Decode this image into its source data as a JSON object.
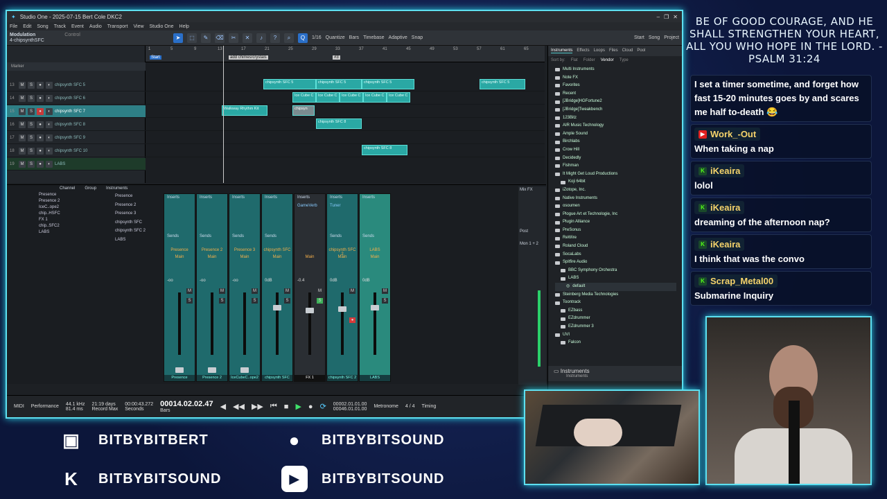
{
  "window": {
    "title": "Studio One - 2025-07-15 Bert Cole DKC2"
  },
  "menu": [
    "File",
    "Edit",
    "Song",
    "Track",
    "Event",
    "Audio",
    "Transport",
    "View",
    "Studio One",
    "Help"
  ],
  "toolbar": {
    "preset": "Modulation",
    "param": "Control",
    "track": "4-chipsynthSFC",
    "quantize": "1/16",
    "timebase": "Bars",
    "snap": "Adaptive",
    "start": "Start",
    "song": "Song",
    "project": "Project",
    "quantize_label": "Quantize",
    "timebase_label": "Timebase",
    "snap_label": "Snap"
  },
  "arrange": {
    "marker_label": "Marker",
    "ruler_ticks": [
      "1",
      "5",
      "9",
      "13",
      "17",
      "21",
      "25",
      "29",
      "33",
      "37",
      "41",
      "45",
      "49",
      "53",
      "57",
      "61",
      "65"
    ],
    "ruler_markers": [
      "Start",
      "add chimes/crystals",
      "#3"
    ],
    "tracks": [
      {
        "num": "13",
        "name": "chipsynth SFC 5"
      },
      {
        "num": "14",
        "name": "chipsynth SFC 6"
      },
      {
        "num": "15",
        "name": "chipsynth SFC 7"
      },
      {
        "num": "16",
        "name": "chipsynth SFC 8"
      },
      {
        "num": "17",
        "name": "chipsynth SFC 9"
      },
      {
        "num": "18",
        "name": "chipsynth SFC 10"
      },
      {
        "num": "19",
        "name": "LABS"
      }
    ],
    "clips": {
      "c1": "chipsynth SFC 5",
      "c2": "chipsynth SFC 5",
      "c3": "chipsynth SFC 5",
      "c4": "chipsynth SFC 5",
      "ice": "Ice Cube C",
      "walk": "Walkway Rhythm Kit",
      "gray": "chipsyn",
      "c8": "chipsynth SFC 8",
      "c8b": "chipsynth SFC 8"
    }
  },
  "browser": {
    "tabs": [
      "Instruments",
      "Effects",
      "Loops",
      "Files",
      "Cloud",
      "Pool"
    ],
    "sort_label": "Sort by:",
    "sort": [
      "Flat",
      "Folder",
      "Vendor",
      "Type"
    ],
    "items": [
      "Multi Instruments",
      "Note FX",
      "Favorites",
      "Recent",
      "[JBridge]HGFortune2",
      "[JBridge]Tweakbench",
      "123Bitz",
      "AIR Music Technology",
      "Ample Sound",
      "Birchlabs",
      "Crow Hill",
      "Decidedly",
      "Fishman",
      "It Might Get Loud Productions",
      "Koji 64bit",
      "iZotope, Inc.",
      "Native Instruments",
      "osoumen",
      "Plogue Art et Technologie, Inc",
      "Plugin Alliance",
      "PreSonus",
      "ReWire",
      "Roland Cloud",
      "SocaLabs",
      "Spitfire Audio",
      "BBC Symphony Orchestra",
      "LABS",
      "default",
      "Steinberg Media Technologies",
      "Toontrack",
      "EZbass",
      "EZdrummer",
      "EZdrummer 3",
      "UVI",
      "Falcon"
    ],
    "footer_title": "Instruments",
    "footer_sub": "Instruments"
  },
  "mixer": {
    "channel_label": "Channel",
    "group_label": "Group",
    "instruments_label": "Instruments",
    "channels": [
      "Presence",
      "Presence 2",
      "IceC..ope2",
      "chip..HSFC",
      "FX 1",
      "chip..SFC2",
      "LABS"
    ],
    "instruments": [
      "Presence",
      "Presence 2",
      "Presence 3",
      "chipsynth SFC",
      "chipsynth SFC 2",
      "LABS"
    ],
    "inserts_label": "Inserts",
    "sends_label": "Sends",
    "strips": [
      {
        "name": "Presence",
        "out": "Main",
        "db": "-oo",
        "bot": "Presence"
      },
      {
        "name": "Presence 2",
        "out": "Main",
        "db": "-oo",
        "bot": "Presence 2"
      },
      {
        "name": "Presence 3",
        "out": "Main",
        "db": "-oo",
        "bot": "IceCubeC..ope2"
      },
      {
        "name": "chipsynth SFC",
        "out": "Main",
        "db": "0dB",
        "bot": "chipsynth SFC"
      },
      {
        "name": "",
        "out": "Main",
        "db": "-0.4",
        "bot": "FX 1"
      },
      {
        "name": "chipsynth SFC 2",
        "out": "Main",
        "db": "0dB",
        "bot": "chipsynth SFC 2"
      },
      {
        "name": "LABS",
        "out": "Main",
        "db": "0dB",
        "bot": "LABS"
      }
    ],
    "fx1": "FX 1",
    "gameverb": "GameVerb",
    "tuner": "Tuner",
    "mix_fx": "Mix FX",
    "post": "Post",
    "mon": "Mon 1 + 2"
  },
  "transport": {
    "rate": "44.1 kHz",
    "latency": "81.4 ms",
    "days": "21:19 days",
    "record_max": "Record Max",
    "seconds": "00:00:43.272",
    "seconds_label": "Seconds",
    "position": "00014.02.02.47",
    "bars_label": "Bars",
    "loop_start": "00002.01.01.00",
    "loop_end": "00046.01.01.00",
    "sig": "4 / 4",
    "metronome": "Metronome",
    "timing": "Timing",
    "midi": "MIDI",
    "perf": "Performance"
  },
  "overlay": {
    "verse": "Be of good courage, and he shall strengthen your heart, all you who hope in the Lord. -Psalm 31:24",
    "chat": [
      {
        "author": "",
        "platform": "",
        "text": "I set a timer sometime, and forget how fast 15-20 minutes goes by and scares me half to-death 😂"
      },
      {
        "author": "Work_-Out",
        "platform": "youtube",
        "text": "When taking a nap"
      },
      {
        "author": "iKeaira",
        "platform": "kick",
        "text": "lolol"
      },
      {
        "author": "iKeaira",
        "platform": "kick",
        "text": "dreaming of the afternoon nap?"
      },
      {
        "author": "iKeaira",
        "platform": "kick",
        "text": "I think that was the convo"
      },
      {
        "author": "Scrap_Metal00",
        "platform": "kick",
        "text": "Submarine Inquiry"
      }
    ],
    "socials": [
      {
        "icon": "twitch-icon",
        "handle": "BITBYBITBERT"
      },
      {
        "icon": "patreon-icon",
        "handle": "BITBYBITSOUND"
      },
      {
        "icon": "kick-icon",
        "handle": "BITBYBITSOUND"
      },
      {
        "icon": "youtube-icon",
        "handle": "BITBYBITSOUND"
      }
    ]
  }
}
